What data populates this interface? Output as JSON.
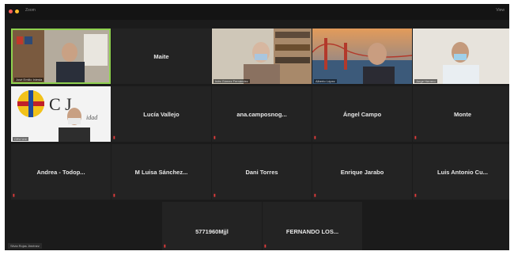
{
  "window": {
    "title": "Zoom",
    "view_label": "View"
  },
  "tiles": [
    {
      "name": "",
      "caption": "José Emilio Iniesta"
    },
    {
      "name": "Maite"
    },
    {
      "name": "",
      "caption": "Inés Gómez Fernández"
    },
    {
      "name": "",
      "caption": "Alberto López"
    },
    {
      "name": "",
      "caption": "Jorge Herrero"
    },
    {
      "name": "",
      "caption": "CEU Uni"
    },
    {
      "name": "Lucía Vallejo"
    },
    {
      "name": "ana.camposnog..."
    },
    {
      "name": "Ángel Campo"
    },
    {
      "name": "Monte"
    },
    {
      "name": "Andrea - Todop..."
    },
    {
      "name": "M Luisa Sánchez..."
    },
    {
      "name": "Dani Torres"
    },
    {
      "name": "Enrique Jarabo"
    },
    {
      "name": "Luis Antonio Cu..."
    },
    {
      "name": "5771960Mjjl"
    },
    {
      "name": "FERNANDO LOS..."
    }
  ],
  "bottom_label": "Silvia Rojas Jiménez",
  "colors": {
    "active_border": "#8fd14f",
    "mic_muted": "#e23b3b",
    "tile_bg": "#232323"
  }
}
